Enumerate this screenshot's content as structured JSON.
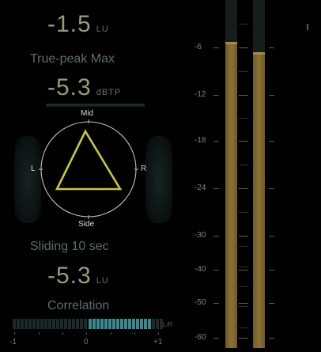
{
  "loudness_top": {
    "value": "-1.5",
    "unit": "LU"
  },
  "true_peak": {
    "label": "True-peak Max",
    "value": "-5.3",
    "unit": "dBTP"
  },
  "vectorscope": {
    "mid": "Mid",
    "side": "Side",
    "left": "L",
    "right": "R",
    "accent": "#c8c83a"
  },
  "sliding": {
    "label": "Sliding 10 sec",
    "value": "-5.3",
    "unit": "LU"
  },
  "correlation": {
    "label": "Correlation",
    "lr": "L/R",
    "scale": [
      "-1",
      "0",
      "+1"
    ],
    "active_range": [
      0,
      0.85
    ]
  },
  "meter": {
    "scale_labels": [
      "-6",
      "-12",
      "-18",
      "-24",
      "-30",
      "-40",
      "-50",
      "-60"
    ],
    "left_level_db": -5.5,
    "right_level_db": -6.8,
    "bar_color": "#8c7234"
  }
}
